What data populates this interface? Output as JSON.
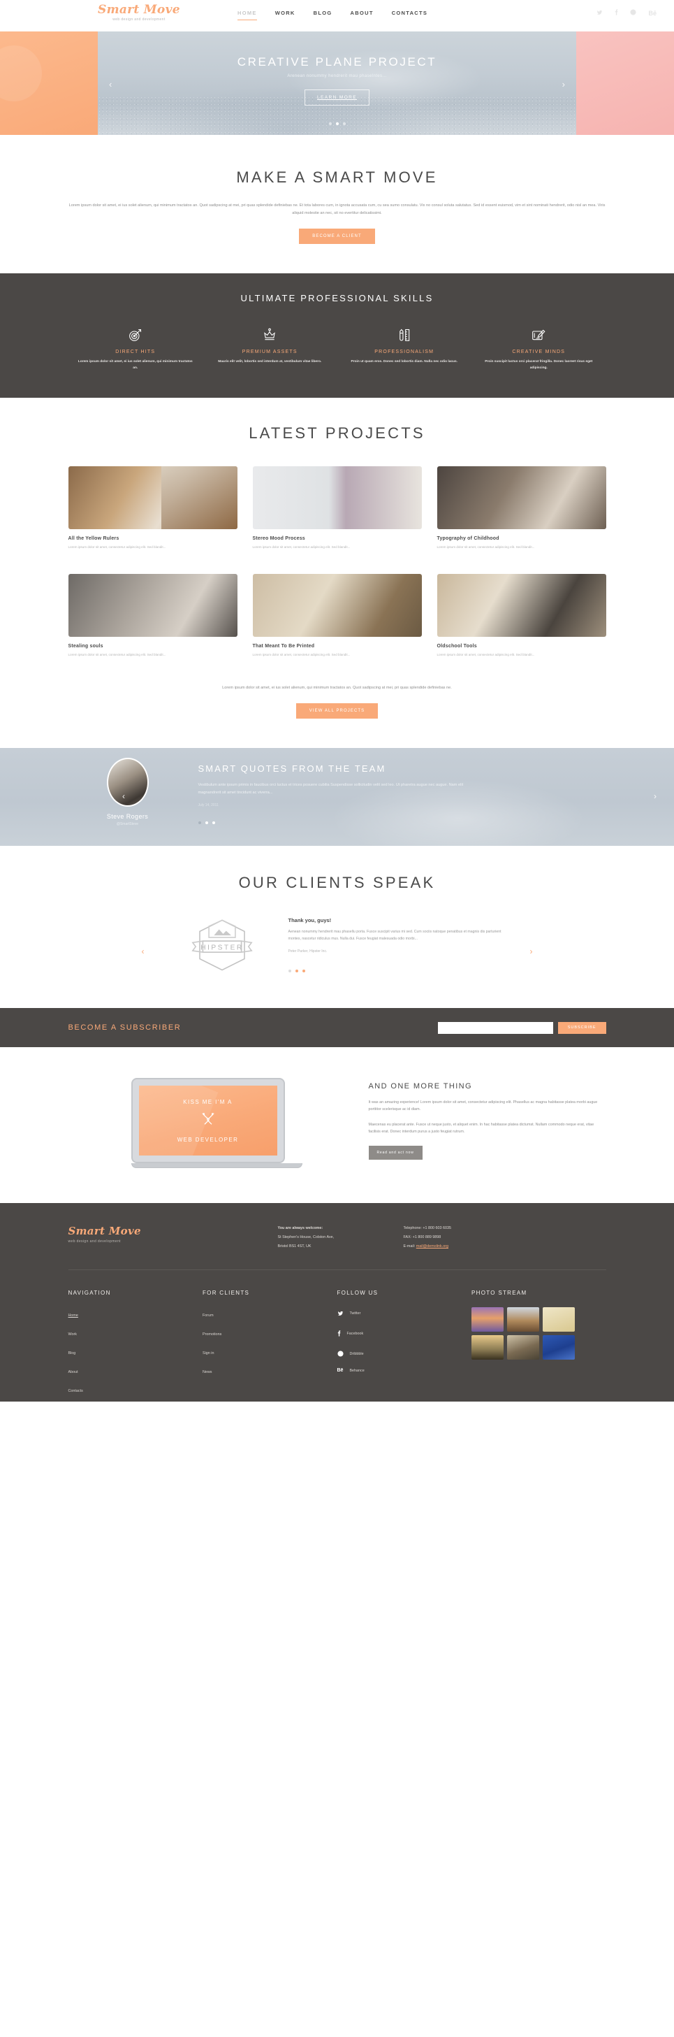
{
  "header": {
    "logo": "Smart Move",
    "logo_tagline": "web design and development",
    "nav": [
      {
        "label": "HOME",
        "active": true
      },
      {
        "label": "WORK",
        "active": false
      },
      {
        "label": "BLOG",
        "active": false
      },
      {
        "label": "ABOUT",
        "active": false
      },
      {
        "label": "CONTACTS",
        "active": false
      }
    ],
    "social": [
      "twitter-icon",
      "facebook-icon",
      "dribbble-icon",
      "behance-icon"
    ]
  },
  "hero": {
    "title": "CREATIVE PLANE PROJECT",
    "subtitle": "Arenean nonummy hendrerit mau phaselntes...",
    "button": "LEARN MORE",
    "prev": "‹",
    "next": "›",
    "slides": 3,
    "active_slide": 2
  },
  "intro": {
    "title": "MAKE A SMART MOVE",
    "paragraph": "Lorem ipsum dolor sit amet, ei ius solet alienum, qui minimum tractatos an. Quot sadipscing at mei, pri quas splendide definiebas ne. Et tota labores cum, in ignota accusata cum, cu sea sumo consulatu. Vix no consul soluta salutatus. Sed id essent euismod, vim et sint nominati hendrerit, odio nisl an mea. Viris aliquid molestie an nec, sit no evertitur delicatissimi.",
    "button": "BECOME A CLIENT"
  },
  "skills": {
    "title": "ULTIMATE PROFESSIONAL SKILLS",
    "items": [
      {
        "icon": "target-arrow-icon",
        "title": "DIRECT HITS",
        "text": "Lorem ipsum dolor sit amet, ei ius solet alienum, qui minimum tractatos an."
      },
      {
        "icon": "crown-icon",
        "title": "PREMIUM ASSETS",
        "text": "Mauris elit velit, lobortis sed interdum at, vestibulum vitae libero."
      },
      {
        "icon": "pencil-ruler-icon",
        "title": "PROFESSIONALISM",
        "text": "Proin ut quam eros. Donec sed lobortis diam. Nulla nec odio lacus."
      },
      {
        "icon": "graphics-tablet-icon",
        "title": "CREATIVE MINDS",
        "text": "Proin suscipit luctus orci placerat fringilla. Donec laoreet risus eget adipiscing."
      }
    ]
  },
  "projects": {
    "title": "LATEST PROJECTS",
    "excerpt": "Lorem ipsum dolor sit amet, consectetur adipiscing elit. Sed blandit...",
    "items": [
      {
        "title": "All the Yellow Rulers",
        "thumb": "workbench-tools-photo"
      },
      {
        "title": "Stereo Mood Process",
        "thumb": "speaker-desk-photo"
      },
      {
        "title": "Typography of Childhood",
        "thumb": "print-shirt-photo"
      },
      {
        "title": "Stealing souls",
        "thumb": "vintage-cameras-photo"
      },
      {
        "title": "That Meant To Be Printed",
        "thumb": "letterpress-photo"
      },
      {
        "title": "Oldschool Tools",
        "thumb": "leather-tools-photo"
      }
    ],
    "footer_text": "Lorem ipsum dolor sit amet, ei ius solet alienum, qui minimum tractatos an. Quot sadipscing at mei, pri quas splendide definiebas ne.",
    "button": "VIEW ALL PROJECTS"
  },
  "testimonial": {
    "title": "SMART QUOTES FROM THE TEAM",
    "quote": "Vestibulum ante ipsum primis in faucibus orci luctus et trices posuere cubilia Suspendisse sollicitudin velit sed leo. Ut pharetra augue nec augue. Nam elit magnandrerit sit amet tincidunt ac viverra...",
    "date": "July 14, 2011",
    "author": "Steve Rogers",
    "handle": "@SmartSteve",
    "prev": "‹",
    "next": "›",
    "dots": 3,
    "active_dot": 1
  },
  "clients": {
    "title": "OUR CLIENTS SPEAK",
    "logo_text": "HIPSTER",
    "heading": "Thank you, guys!",
    "text": "Aenean nonummy hendrerit mau phasellu porta. Fusce suscipit varius mi sed. Cum sociis natoque penatibus et magnis dis parturient montes, nascetur ridiculus mus. Nulla dui. Fusce feugiat malesuada odio morbi...",
    "author": "Peter Parker, Hipster Inc.",
    "prev": "‹",
    "next": "›",
    "dots": 3,
    "active_dot": 1
  },
  "subscribe": {
    "title": "BECOME A SUBSCRIBER",
    "input_value": "",
    "input_placeholder": "",
    "button": "SUBSCRIBE"
  },
  "onemore": {
    "screen_line1": "KISS ME I'M A",
    "screen_icon": "crossed-tools-icon",
    "screen_line2": "WEB DEVELOPER",
    "title": "AND ONE MORE THING",
    "paragraph1": "It was an amazing experience! Lorem ipsum dolor sit amet, consectetur adipiscing elit. Phasellus ac magna habitasse platea morbi augue porttitor scelerisque ac id diam.",
    "paragraph2": "Maecenas eu placerat ante. Fusce ut neque justo, et aliquet enim. In hac habitasse platea dictumst. Nullam commodo neque erat, vitae facilisis erat. Donec interdum purus a justo feugiat rutrum.",
    "button": "Read and act now"
  },
  "footer": {
    "logo": "Smart Move",
    "logo_tagline": "web design and development",
    "address_label": "You are always welcome:",
    "address_line1": "St Stephen's House, Colston Ave,",
    "address_line2": "Bristol BS1 4ST, UK",
    "telephone": "Telephone: +1 800 603 6035",
    "fax": "FAX: +1 800 889 9898",
    "email_label": "E-mail:",
    "email": "mail@demolink.org",
    "columns": [
      {
        "title": "NAVIGATION",
        "items": [
          {
            "label": "Home",
            "active": true
          },
          {
            "label": "Work",
            "active": false
          },
          {
            "label": "Blog",
            "active": false
          },
          {
            "label": "About",
            "active": false
          },
          {
            "label": "Contacts",
            "active": false
          }
        ]
      },
      {
        "title": "FOR CLIENTS",
        "items": [
          {
            "label": "Forum",
            "active": false
          },
          {
            "label": "Promotions",
            "active": false
          },
          {
            "label": "Sign in",
            "active": false
          },
          {
            "label": "News",
            "active": false
          }
        ]
      }
    ],
    "follow_title": "FOLLOW US",
    "follow": [
      {
        "icon": "twitter-icon",
        "label": "Twitter"
      },
      {
        "icon": "facebook-icon",
        "label": "Facebook"
      },
      {
        "icon": "dribbble-icon",
        "label": "Dribbble"
      },
      {
        "icon": "behance-icon",
        "label": "Behance"
      }
    ],
    "photo_title": "PHOTO STREAM",
    "photos": [
      "sunset-lake-photo",
      "canyon-road-photo",
      "golden-haze-photo",
      "dusk-field-photo",
      "rocky-shore-photo",
      "blue-texture-photo"
    ]
  },
  "colors": {
    "accent": "#f9a978",
    "dark": "#4b4846",
    "text": "#4a4a4a",
    "muted": "#9a9a9a"
  }
}
